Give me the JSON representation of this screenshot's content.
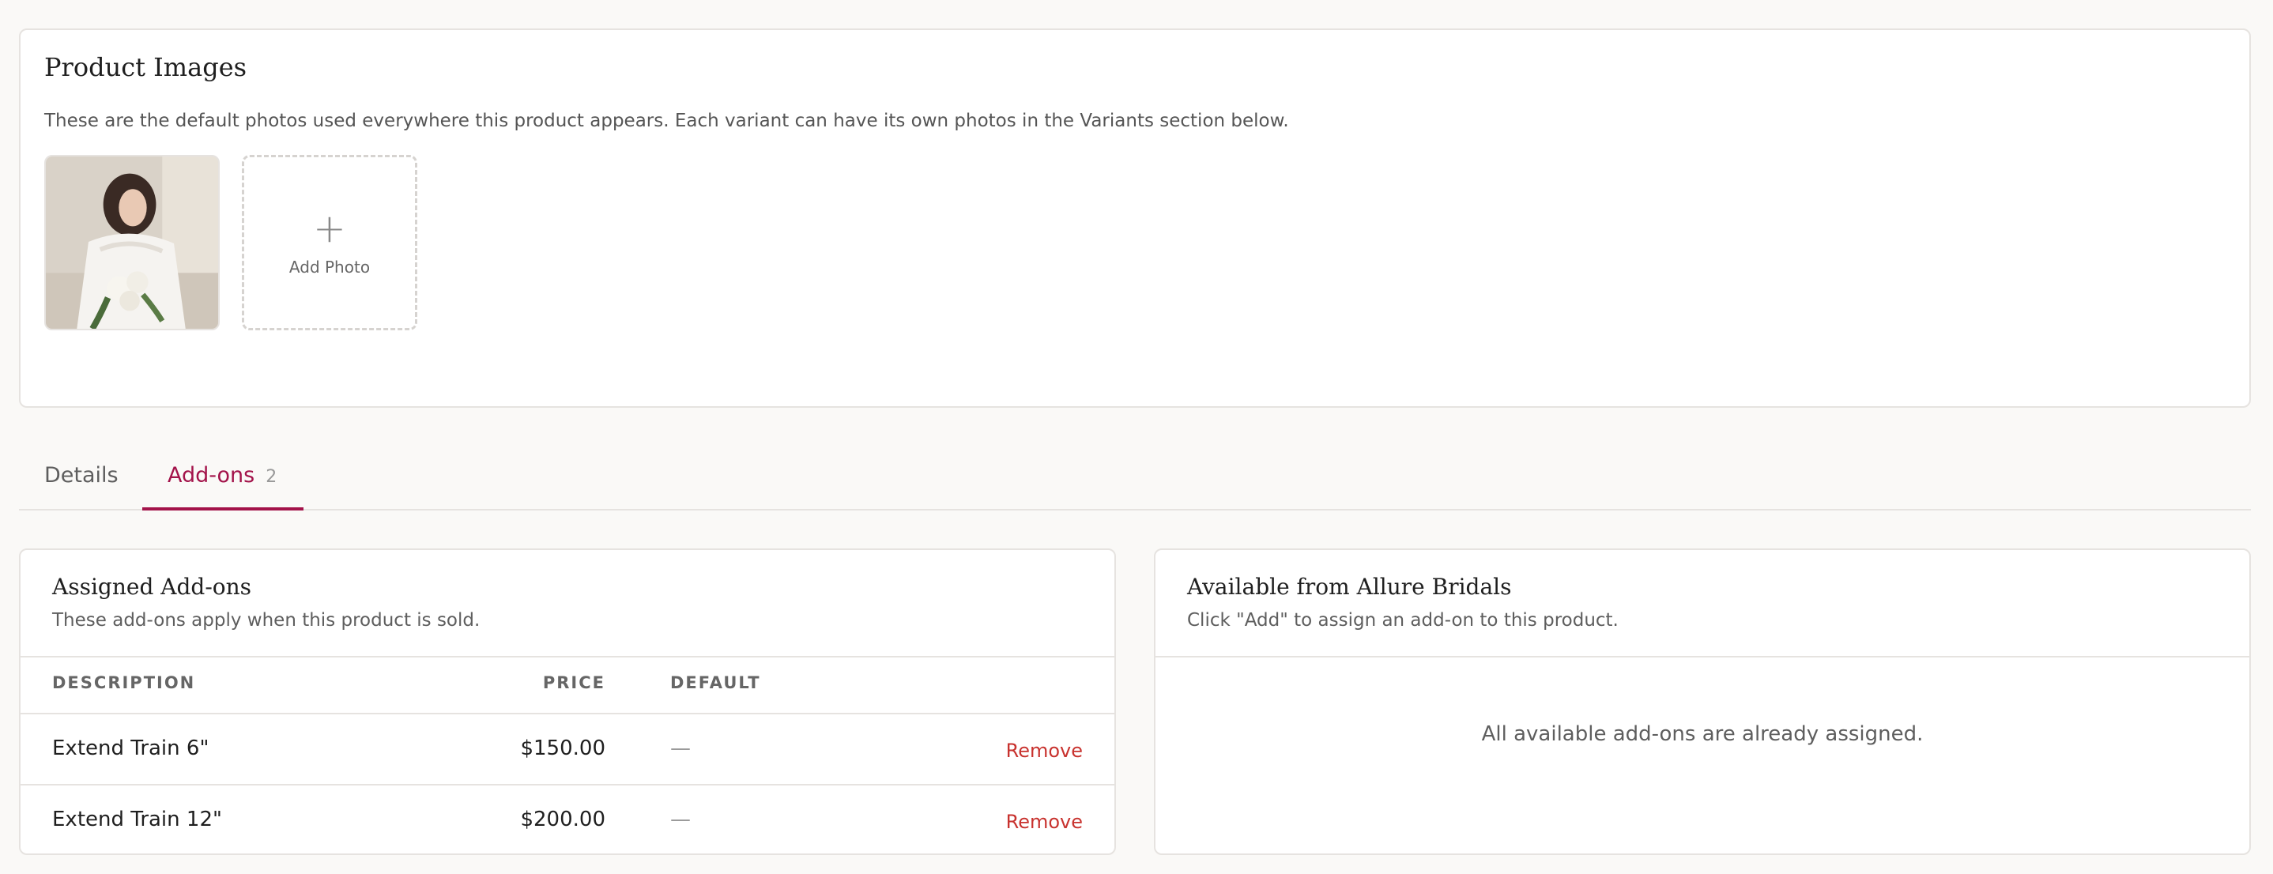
{
  "product_images": {
    "title": "Product Images",
    "description": "These are the default photos used everywhere this product appears. Each variant can have its own photos in the Variants section below.",
    "add_photo_label": "Add Photo",
    "plus_glyph": "+"
  },
  "tabs": [
    {
      "label": "Details",
      "active": false
    },
    {
      "label": "Add-ons",
      "count": "2",
      "active": true
    }
  ],
  "assigned": {
    "title": "Assigned Add-ons",
    "subtitle": "These add-ons apply when this product is sold.",
    "columns": {
      "description": "DESCRIPTION",
      "price": "PRICE",
      "default": "DEFAULT"
    },
    "rows": [
      {
        "description": "Extend Train 6\"",
        "price": "$150.00",
        "default": "—",
        "action": "Remove"
      },
      {
        "description": "Extend Train 12\"",
        "price": "$200.00",
        "default": "—",
        "action": "Remove"
      }
    ]
  },
  "available": {
    "title": "Available from Allure Bridals",
    "subtitle": "Click \"Add\" to assign an add-on to this product.",
    "empty_message": "All available add-ons are already assigned."
  },
  "colors": {
    "accent": "#a3134a",
    "danger": "#c8322e",
    "border": "#e6e3e0",
    "background": "#faf9f7"
  }
}
